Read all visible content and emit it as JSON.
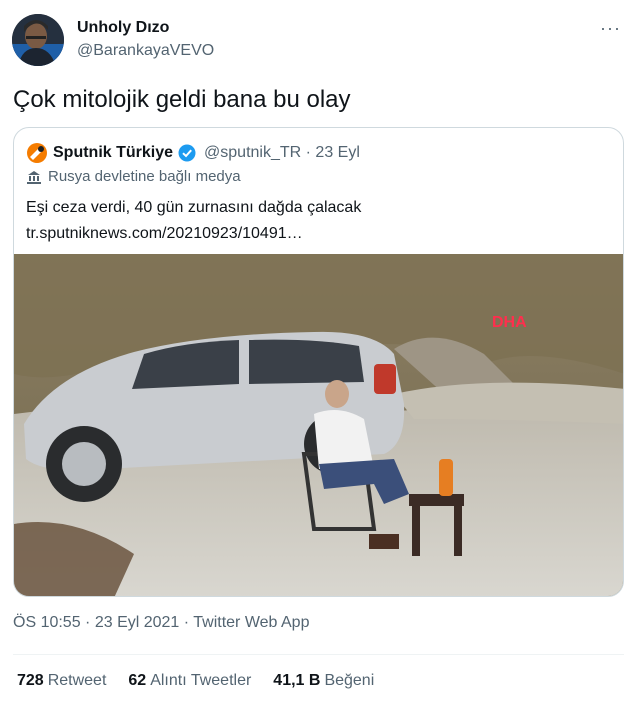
{
  "author": {
    "name": "Unholy Dızo",
    "handle": "@BarankayaVEVO"
  },
  "more_label": "···",
  "tweet_text": "Çok mitolojik geldi bana bu olay",
  "quote": {
    "name": "Sputnik Türkiye",
    "handle": "@sputnik_TR · 23 Eyl",
    "label": "Rusya devletine bağlı medya",
    "text_line1": "Eşi ceza verdi, 40 gün zurnasını dağda çalacak",
    "text_line2": "tr.sputniknews.com/20210923/10491…",
    "media_watermark": "DHA"
  },
  "meta": "ÖS 10:55 · 23 Eyl 2021 · Twitter Web App",
  "stats": {
    "retweets_count": "728",
    "retweets_label": "Retweet",
    "quotes_count": "62",
    "quotes_label": "Alıntı Tweetler",
    "likes_count": "41,1 B",
    "likes_label": "Beğeni"
  },
  "colors": {
    "primary_text": "#0f1419",
    "secondary_text": "#536471",
    "border": "#cfd9de",
    "verified": "#1d9bf0",
    "sputnik_brand": "#f57c00"
  },
  "icons": {
    "more": "more-horizontal-icon",
    "verified": "verified-badge-icon",
    "state_media": "state-media-icon",
    "logo": "sputnik-logo-icon"
  }
}
